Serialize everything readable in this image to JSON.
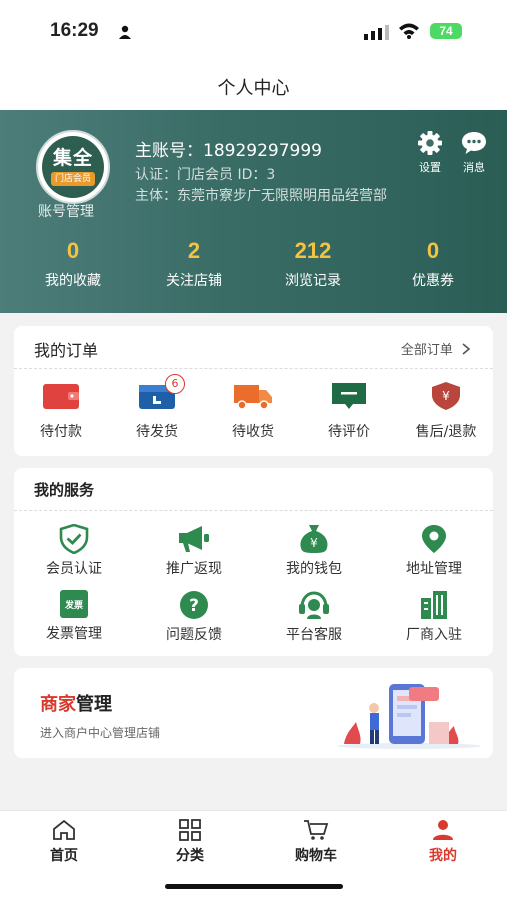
{
  "status": {
    "time": "16:29",
    "battery": "74"
  },
  "nav": {
    "title": "个人中心"
  },
  "profile": {
    "logo_name": "集全",
    "logo_tag": "门店会员",
    "account_mgmt": "账号管理",
    "account_line": "主账号：18929297999",
    "cert_line": "认证：门店会员  ID：3",
    "subject_line": "主体：东莞市寮步广无限照明用品经营部",
    "settings_label": "设置",
    "messages_label": "消息"
  },
  "stats": [
    {
      "value": "0",
      "label": "我的收藏"
    },
    {
      "value": "2",
      "label": "关注店铺"
    },
    {
      "value": "212",
      "label": "浏览记录"
    },
    {
      "value": "0",
      "label": "优惠券"
    }
  ],
  "orders": {
    "title": "我的订单",
    "all_link": "全部订单",
    "items": [
      {
        "label": "待付款",
        "icon": "wallet-icon"
      },
      {
        "label": "待发货",
        "icon": "calendar-icon",
        "badge": "6"
      },
      {
        "label": "待收货",
        "icon": "truck-icon"
      },
      {
        "label": "待评价",
        "icon": "comment-icon"
      },
      {
        "label": "售后/退款",
        "icon": "yen-shield-icon"
      }
    ]
  },
  "services": {
    "title": "我的服务",
    "items": [
      {
        "label": "会员认证",
        "icon": "shield-check-icon"
      },
      {
        "label": "推广返现",
        "icon": "megaphone-icon"
      },
      {
        "label": "我的钱包",
        "icon": "money-bag-icon"
      },
      {
        "label": "地址管理",
        "icon": "location-pin-icon"
      },
      {
        "label": "发票管理",
        "icon": "invoice-icon",
        "icon_text": "发票"
      },
      {
        "label": "问题反馈",
        "icon": "question-icon"
      },
      {
        "label": "平台客服",
        "icon": "headset-icon"
      },
      {
        "label": "厂商入驻",
        "icon": "buildings-icon"
      }
    ]
  },
  "merchant": {
    "title_red": "商家",
    "title_black": "管理",
    "subtitle": "进入商户中心管理店铺"
  },
  "tabs": [
    {
      "label": "首页",
      "icon": "home-icon"
    },
    {
      "label": "分类",
      "icon": "grid-icon"
    },
    {
      "label": "购物车",
      "icon": "cart-icon"
    },
    {
      "label": "我的",
      "icon": "user-icon"
    }
  ],
  "colors": {
    "header": "#3a6c66",
    "accent_red": "#d93a2f",
    "stat_number": "#f5c242",
    "icon_green": "#2e7d4f"
  }
}
